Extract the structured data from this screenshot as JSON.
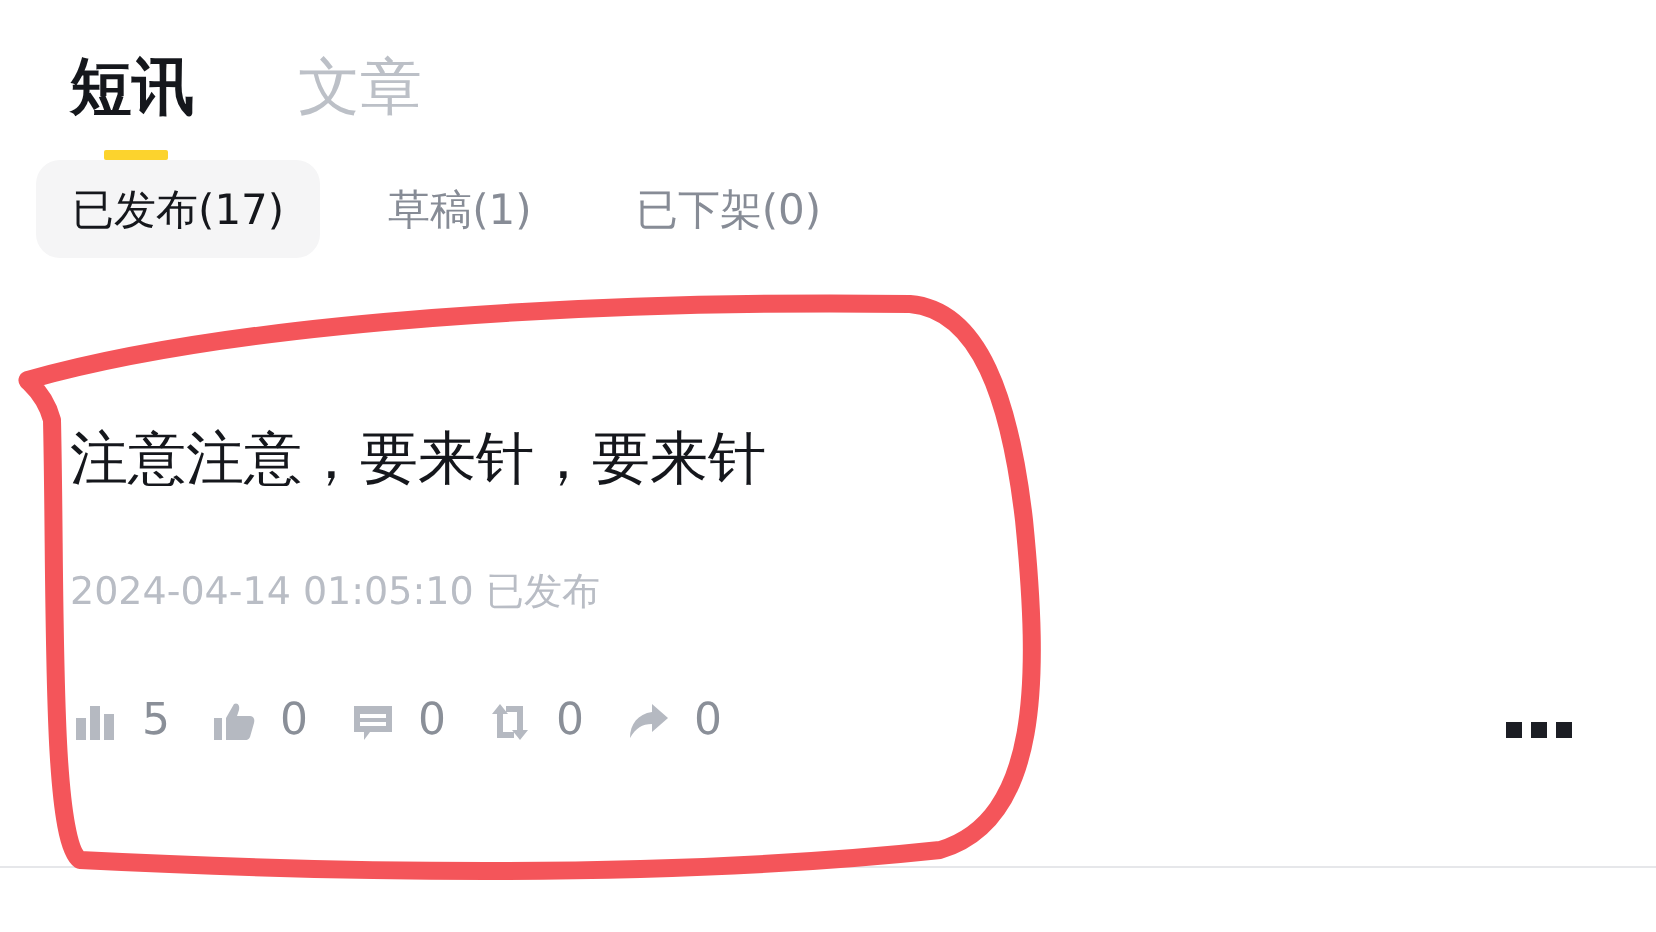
{
  "tabs": [
    {
      "label": "短讯",
      "selected": true
    },
    {
      "label": "文章",
      "selected": false
    }
  ],
  "filters": [
    {
      "label": "已发布(17)",
      "selected": true
    },
    {
      "label": "草稿(1)",
      "selected": false
    },
    {
      "label": "已下架(0)",
      "selected": false
    }
  ],
  "post": {
    "text": "注意注意，要来针，要来针",
    "meta": "2024-04-14 01:05:10 已发布",
    "stats": [
      {
        "kind": "views",
        "count": "5"
      },
      {
        "kind": "likes",
        "count": "0"
      },
      {
        "kind": "comments",
        "count": "0"
      },
      {
        "kind": "reposts",
        "count": "0"
      },
      {
        "kind": "shares",
        "count": "0"
      }
    ]
  }
}
